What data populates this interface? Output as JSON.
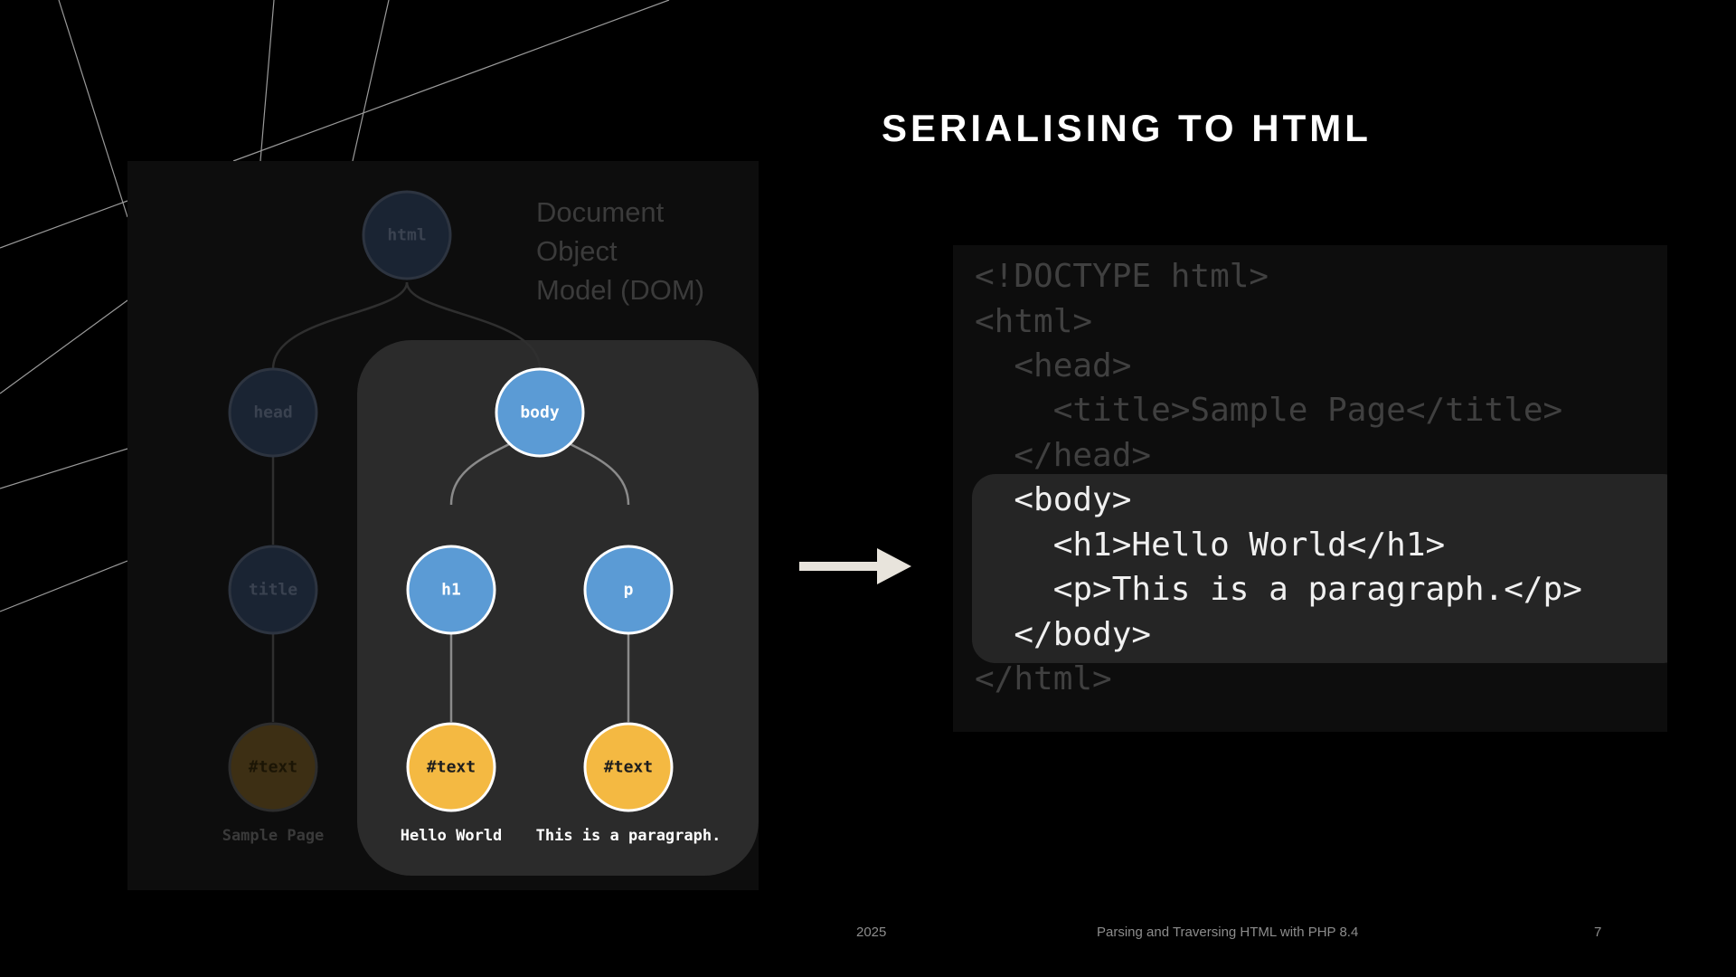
{
  "slide": {
    "title": "SERIALISING TO HTML"
  },
  "dom": {
    "caption": [
      "Document",
      "Object",
      "Model (DOM)"
    ],
    "nodes": {
      "html": "html",
      "head": "head",
      "body": "body",
      "title": "title",
      "h1": "h1",
      "p": "p",
      "text_title": "#text",
      "text_h1": "#text",
      "text_p": "#text"
    },
    "leaf_labels": {
      "sample_page": "Sample Page",
      "hello_world": "Hello World",
      "paragraph": "This is a paragraph."
    },
    "colors": {
      "element": "#5b9bd5",
      "text_node": "#f4b942",
      "highlight": "#2b2b2b"
    }
  },
  "code": {
    "lines": [
      "<!DOCTYPE html>",
      "<html>",
      "  <head>",
      "    <title>Sample Page</title>",
      "  </head>",
      "  <body>",
      "    <h1>Hello World</h1>",
      "    <p>This is a paragraph.</p>",
      "  </body>",
      "</html>"
    ]
  },
  "footer": {
    "year": "2025",
    "presentation_title": "Parsing and Traversing HTML with PHP 8.4",
    "page_number": "7"
  }
}
